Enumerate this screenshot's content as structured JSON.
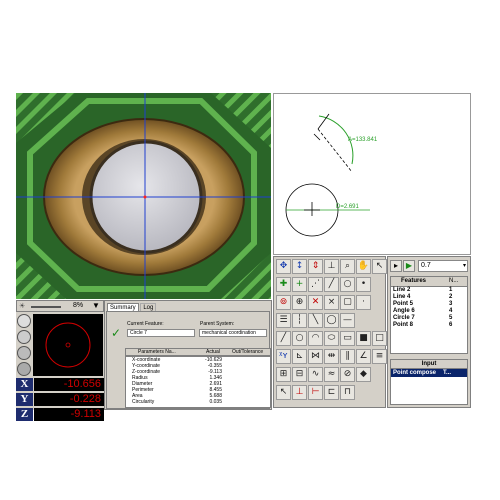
{
  "sketch": {
    "angle_label": "A=133.841",
    "diameter_label": "D=2.691"
  },
  "toolbar_top": {
    "zoom_value": "0.7"
  },
  "features": {
    "header_name": "Features",
    "header_num": "N...",
    "items": [
      {
        "name": "Line 2",
        "num": "1"
      },
      {
        "name": "Line 4",
        "num": "2"
      },
      {
        "name": "Point 5",
        "num": "3"
      },
      {
        "name": "Angle 6",
        "num": "4"
      },
      {
        "name": "Circle 7",
        "num": "5"
      },
      {
        "name": "Point 8",
        "num": "6"
      }
    ],
    "input_header": "Input",
    "input_item": "Point compose",
    "input_value": "T..."
  },
  "instrument": {
    "light_percent": "8%",
    "dro": [
      {
        "axis": "X",
        "value": "-10.656"
      },
      {
        "axis": "Y",
        "value": "-0.228"
      },
      {
        "axis": "Z",
        "value": "-9.113"
      }
    ]
  },
  "summary": {
    "tabs": [
      "Summary",
      "Log"
    ],
    "current_feature_label": "Current Feature:",
    "current_feature_value": "Circle 7",
    "parent_system_label": "Parent System:",
    "parent_system_value": "mechanical coordination",
    "table_headers": [
      "Parameters Na...",
      "Actual",
      "Out/Tolerance"
    ],
    "rows": [
      {
        "name": "X-coordinate",
        "value": "-10.629"
      },
      {
        "name": "Y-coordinate",
        "value": "-0.355"
      },
      {
        "name": "Z-coordinate",
        "value": "-9.113"
      },
      {
        "name": "Radius",
        "value": "1.346"
      },
      {
        "name": "Diameter",
        "value": "2.691"
      },
      {
        "name": "Perimeter",
        "value": "8.455"
      },
      {
        "name": "Area",
        "value": "5.688"
      },
      {
        "name": "Circularity",
        "value": "0.035"
      }
    ]
  }
}
